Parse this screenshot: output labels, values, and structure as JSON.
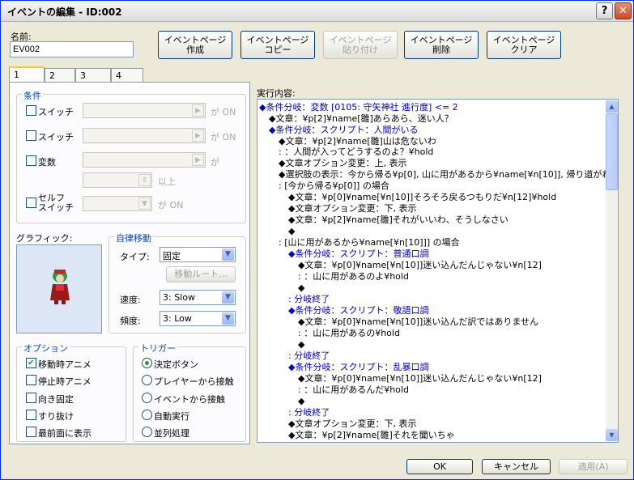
{
  "window": {
    "title": "イベントの編集 - ID:002",
    "help_glyph": "?",
    "close_glyph": "✕"
  },
  "name": {
    "label": "名前:",
    "value": "EV002"
  },
  "toolbar": {
    "new_page": "イベントページ\n作成",
    "copy_page": "イベントページ\nコピー",
    "paste_page": "イベントページ\n貼り付け",
    "delete_page": "イベントページ\n削除",
    "clear_page": "イベントページ\nクリア"
  },
  "tabs": [
    "1",
    "2",
    "3",
    "4"
  ],
  "conditions": {
    "title": "条件",
    "switch1": "スイッチ",
    "switch2": "スイッチ",
    "variable": "変数",
    "self_switch_a": "セルフ",
    "self_switch_b": "スイッチ",
    "on1": "が ON",
    "on2": "が ON",
    "ga": "が",
    "ijou": "以上",
    "on3": "が ON"
  },
  "graphic": {
    "label": "グラフィック:"
  },
  "autonomous": {
    "title": "自律移動",
    "type_label": "タイプ:",
    "type_value": "固定",
    "route_button": "移動ルート...",
    "speed_label": "速度:",
    "speed_value": "3: Slow",
    "freq_label": "頻度:",
    "freq_value": "3: Low"
  },
  "options": {
    "title": "オプション",
    "items": [
      "移動時アニメ",
      "停止時アニメ",
      "向き固定",
      "すり抜け",
      "最前面に表示"
    ]
  },
  "trigger": {
    "title": "トリガー",
    "items": [
      "決定ボタン",
      "プレイヤーから接触",
      "イベントから接触",
      "自動実行",
      "並列処理"
    ]
  },
  "contents": {
    "label": "実行内容:",
    "lines": [
      "◆条件分岐：変数 [0105: 守矢神社 進行度] <= 2",
      "◆文章：¥p[2]¥name[雛]あらあら、迷い人？",
      "◆条件分岐：スクリプト：人間がいる",
      "◆文章：¥p[2]¥name[雛]山は危ないわ",
      ":              ：人間が入ってどうするのよ？¥hold",
      "◆文章オプション変更：上, 表示",
      "◆選択肢の表示：今から帰る¥p[0], 山に用があるから¥name[¥n[10]], 帰り道がわから",
      ":  [今から帰る¥p[0]] の場合",
      "◆文章：¥p[0]¥name[¥n[10]]そろそろ戻るつもりだ¥n[12]¥hold",
      "◆文章オプション変更：下, 表示",
      "◆文章：¥p[2]¥name[雛]それがいいわ、そうしなさい",
      "◆",
      ":  [山に用があるから¥name[¥n[10]]] の場合",
      "◆条件分岐：スクリプト：普通口調",
      "◆文章：¥p[0]¥name[¥n[10]]迷い込んだんじゃない¥n[12]",
      ":              ：山に用があるのよ¥hold",
      "◆",
      ":  分岐終了",
      "◆条件分岐：スクリプト：敬語口調",
      "◆文章：¥p[0]¥name[¥n[10]]迷い込んだ訳ではありません",
      ":              ：山に用があるの¥hold",
      "◆",
      ":  分岐終了",
      "◆条件分岐：スクリプト：乱暴口調",
      "◆文章：¥p[0]¥name[¥n[10]]迷い込んだんじゃない¥n[12]",
      ":              ：山に用があるんだ¥hold",
      "◆",
      ":  分岐終了",
      "◆文章オプション変更：下, 表示",
      "◆文章：¥p[2]¥name[雛]それを聞いちゃ"
    ]
  },
  "footer": {
    "ok": "OK",
    "cancel": "キャンセル",
    "apply": "適用(A)"
  },
  "icons": {
    "arrow_up": "▲",
    "arrow_down": "▼",
    "arrow_right": "▶",
    "spin": "⇕",
    "check": "✔"
  }
}
